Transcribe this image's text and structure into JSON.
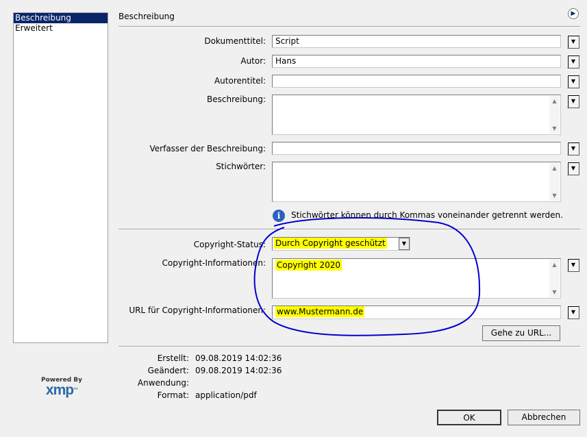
{
  "sidebar": {
    "items": [
      {
        "label": "Beschreibung"
      },
      {
        "label": "Erweitert"
      }
    ]
  },
  "logo": {
    "top": "Powered By",
    "main": "xmp",
    "mark": "™"
  },
  "section_title": "Beschreibung",
  "fields": {
    "dokumenttitel": {
      "label": "Dokumenttitel:",
      "value": "Script"
    },
    "autor": {
      "label": "Autor:",
      "value": "Hans"
    },
    "autorentitel": {
      "label": "Autorentitel:",
      "value": ""
    },
    "beschreibung": {
      "label": "Beschreibung:",
      "value": ""
    },
    "verfasser": {
      "label": "Verfasser der Beschreibung:",
      "value": ""
    },
    "stichwoerter": {
      "label": "Stichwörter:",
      "value": ""
    }
  },
  "info_text": "Stichwörter können durch Kommas voneinander getrennt werden.",
  "copyright": {
    "status_label": "Copyright-Status:",
    "status_value": "Durch Copyright geschützt",
    "info_label": "Copyright-Informationen:",
    "info_value": "Copyright 2020",
    "url_label": "URL für Copyright-Informationen:",
    "url_value": "www.Mustermann.de",
    "goto_button": "Gehe zu URL..."
  },
  "meta": [
    {
      "label": "Erstellt:",
      "value": "09.08.2019 14:02:36"
    },
    {
      "label": "Geändert:",
      "value": "09.08.2019 14:02:36"
    },
    {
      "label": "Anwendung:",
      "value": ""
    },
    {
      "label": "Format:",
      "value": "application/pdf"
    }
  ],
  "buttons": {
    "ok": "OK",
    "cancel": "Abbrechen"
  },
  "icons": {
    "expand": "expand-arrow-icon",
    "info": "info-icon",
    "dropdown": "chevron-down-icon"
  },
  "colors": {
    "selection": "#0a246a",
    "highlight": "#ffff00",
    "annotation": "#0000cc"
  }
}
